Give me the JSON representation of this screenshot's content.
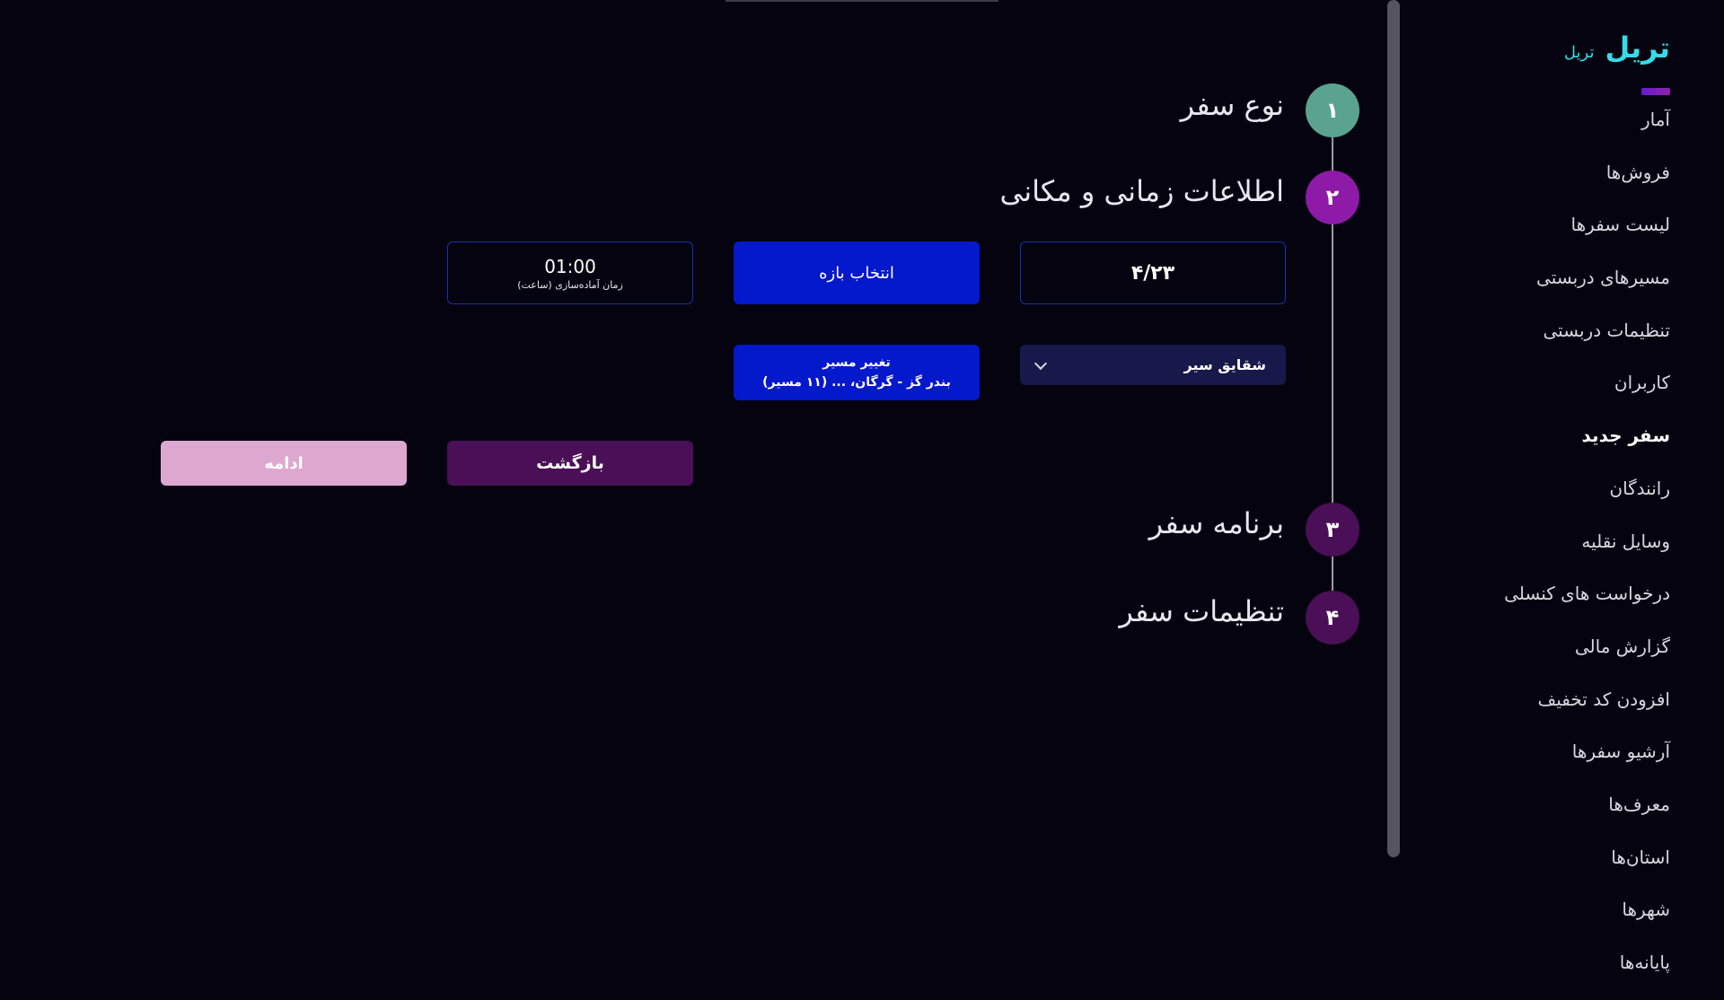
{
  "brand": {
    "name": "تریل",
    "subtitle": "تریل"
  },
  "sidebar": {
    "items": [
      {
        "label": "آمار",
        "active": false
      },
      {
        "label": "فروش‌ها",
        "active": false
      },
      {
        "label": "لیست سفرها",
        "active": false
      },
      {
        "label": "مسیرهای دربستی",
        "active": false
      },
      {
        "label": "تنظیمات دربستی",
        "active": false
      },
      {
        "label": "کاربران",
        "active": false
      },
      {
        "label": "سفر جدید",
        "active": true
      },
      {
        "label": "رانندگان",
        "active": false
      },
      {
        "label": "وسایل نقلیه",
        "active": false
      },
      {
        "label": "درخواست های کنسلی",
        "active": false
      },
      {
        "label": "گزارش مالی",
        "active": false
      },
      {
        "label": "افزودن کد تخفیف",
        "active": false
      },
      {
        "label": "آرشیو سفرها",
        "active": false
      },
      {
        "label": "معرف‌ها",
        "active": false
      },
      {
        "label": "استان‌ها",
        "active": false
      },
      {
        "label": "شهرها",
        "active": false
      },
      {
        "label": "پایانه‌ها",
        "active": false
      }
    ]
  },
  "steps": [
    {
      "number": "۱",
      "title": "نوع سفر",
      "color": "#5aa391"
    },
    {
      "number": "۲",
      "title": "اطلاعات زمانی و مکانی",
      "color": "#8e1aa8"
    },
    {
      "number": "۳",
      "title": "برنامه سفر",
      "color": "#4a0f56"
    },
    {
      "number": "۴",
      "title": "تنظیمات سفر",
      "color": "#4a0f56"
    }
  ],
  "form": {
    "date_value": "۴/۲۳",
    "range_button": "انتخاب بازه",
    "prep_time": {
      "value": "01:00",
      "label": "زمان آماده‌سازی (ساعت)"
    },
    "company": {
      "selected": "شقایق سیر"
    },
    "route_button": {
      "line1": "تغییر مسیر",
      "line2": "بندر گز - گرگان، ... (۱۱ مسیر)"
    },
    "back_button": "بازگشت",
    "continue_button": "ادامه"
  },
  "colors": {
    "accent_cyan": "#35dbe8",
    "primary_blue": "#0418cc",
    "purple": "#8e1aa8",
    "pink": "#dea7cf"
  }
}
